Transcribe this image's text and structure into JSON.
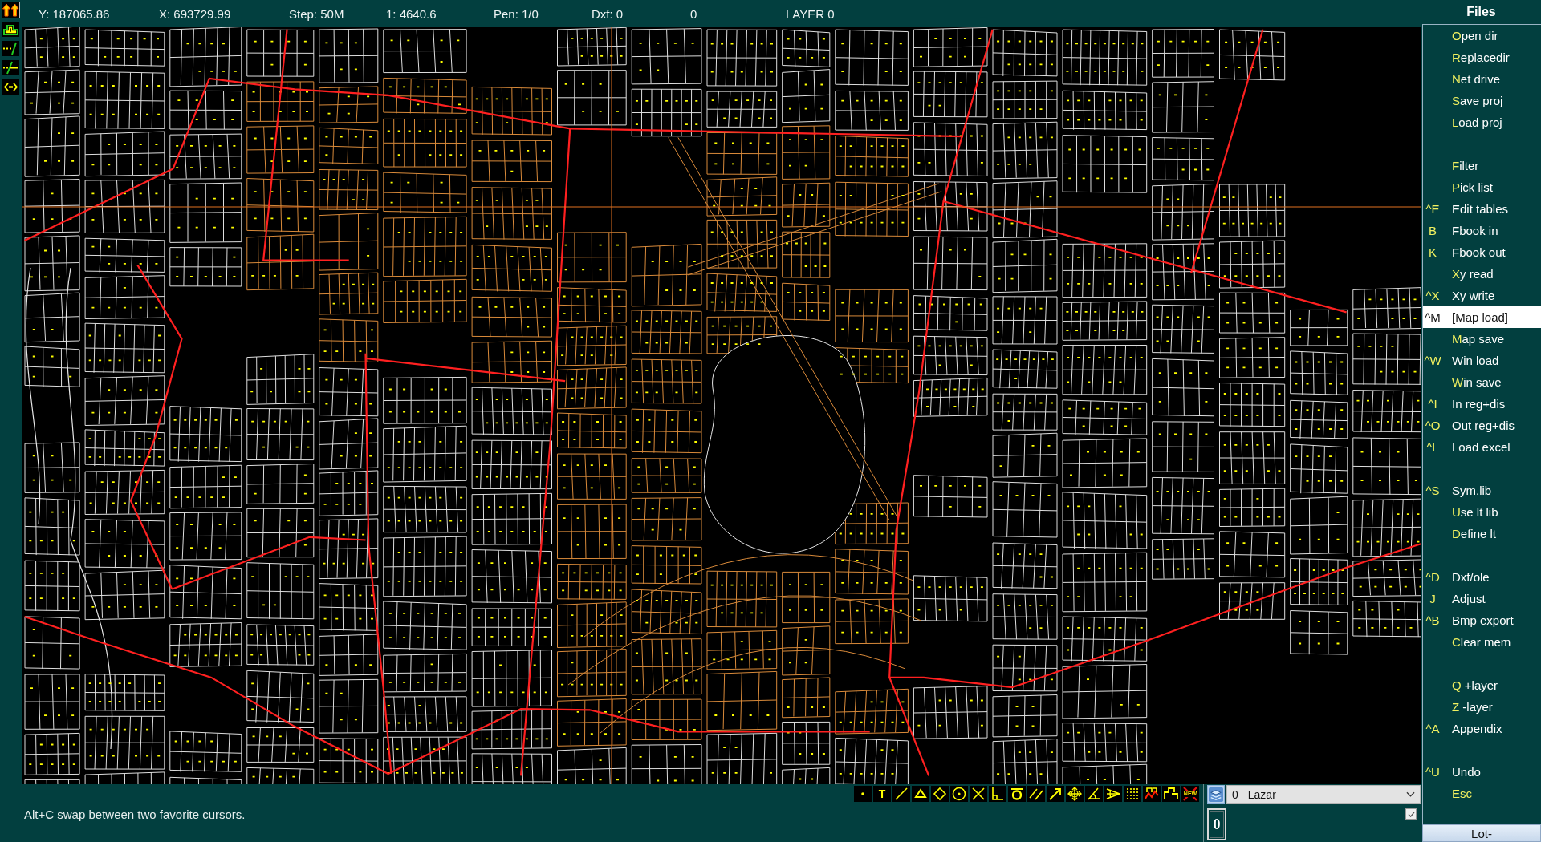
{
  "status_bar": {
    "fields": [
      "Y: 187065.86",
      "X: 693729.99",
      "Step: 50M",
      "1: 4640.6",
      "Pen: 1/0",
      "Dxf: 0",
      "0",
      "LAYER 0"
    ]
  },
  "left_toolbar": [
    {
      "kind": "arrows",
      "selected": true
    },
    {
      "kind": "outline",
      "selected": false
    },
    {
      "kind": "extend",
      "selected": false
    },
    {
      "kind": "trim",
      "selected": false
    },
    {
      "kind": "swap",
      "selected": false
    }
  ],
  "command_bar": {
    "hint": "Alt+C swap between two favorite cursors.",
    "tools": [
      {
        "kind": "point"
      },
      {
        "kind": "text",
        "label": "T"
      },
      {
        "kind": "line"
      },
      {
        "kind": "triangle"
      },
      {
        "kind": "diamond"
      },
      {
        "kind": "circle"
      },
      {
        "kind": "cross"
      },
      {
        "kind": "corner"
      },
      {
        "kind": "ring"
      },
      {
        "kind": "parallel"
      },
      {
        "kind": "arrow"
      },
      {
        "kind": "move"
      },
      {
        "kind": "angle"
      },
      {
        "kind": "fan"
      },
      {
        "kind": "grid"
      },
      {
        "kind": "zigzag"
      },
      {
        "kind": "bracket"
      },
      {
        "kind": "new",
        "label": "NEW"
      }
    ],
    "layer_select": {
      "number": "0",
      "name": "Lazar"
    },
    "checkbox": {
      "checked": true
    },
    "counter": "0"
  },
  "menu": {
    "title": "Files",
    "groups": [
      [
        {
          "kind": "item",
          "label": "Open dir",
          "hotkey": true,
          "selected": false
        },
        {
          "kind": "item",
          "label": "Replacedir",
          "hotkey": true,
          "selected": false
        },
        {
          "kind": "item",
          "label": "Net drive",
          "hotkey": true,
          "selected": false
        },
        {
          "kind": "item",
          "label": "Save proj",
          "hotkey": true,
          "selected": false
        },
        {
          "kind": "item",
          "label": "Load proj",
          "hotkey": true,
          "selected": false
        }
      ],
      [
        {
          "kind": "item",
          "label": "Filter",
          "hotkey": true,
          "selected": false
        },
        {
          "kind": "item",
          "label": "Pick list",
          "hotkey": true,
          "selected": false
        },
        {
          "kind": "item",
          "shortcut": "^E",
          "label": "Edit tables",
          "hotkey": false,
          "selected": false
        },
        {
          "kind": "item",
          "shortcut": "B",
          "label": "Fbook in",
          "hotkey": false,
          "selected": false
        },
        {
          "kind": "item",
          "shortcut": "K",
          "label": "Fbook out",
          "hotkey": false,
          "selected": false
        },
        {
          "kind": "item",
          "label": "Xy read",
          "hotkey": true,
          "selected": false
        },
        {
          "kind": "item",
          "shortcut": "^X",
          "label": "Xy write",
          "hotkey": false,
          "selected": false
        },
        {
          "kind": "item",
          "shortcut": "^M",
          "label": "[Map load]",
          "hotkey": false,
          "selected": true
        },
        {
          "kind": "item",
          "label": "Map save",
          "hotkey": true,
          "selected": false
        },
        {
          "kind": "item",
          "shortcut": "^W",
          "label": "Win load",
          "hotkey": false,
          "selected": false
        },
        {
          "kind": "item",
          "label": "Win save",
          "hotkey": true,
          "selected": false
        },
        {
          "kind": "item",
          "shortcut": "^I",
          "label": "In reg+dis",
          "hotkey": false,
          "selected": false
        },
        {
          "kind": "item",
          "shortcut": "^O",
          "label": "Out reg+dis",
          "hotkey": false,
          "selected": false
        },
        {
          "kind": "item",
          "shortcut": "^L",
          "label": "Load excel",
          "hotkey": false,
          "selected": false
        }
      ],
      [
        {
          "kind": "item",
          "shortcut": "^S",
          "label": "Sym.lib",
          "hotkey": false,
          "selected": false
        },
        {
          "kind": "item",
          "label": "Use lt lib",
          "hotkey": true,
          "selected": false
        },
        {
          "kind": "item",
          "label": "Define lt",
          "hotkey": true,
          "selected": false
        }
      ],
      [
        {
          "kind": "item",
          "shortcut": "^D",
          "label": "Dxf/ole",
          "hotkey": false,
          "selected": false
        },
        {
          "kind": "item",
          "shortcut": "J",
          "label": "Adjust",
          "hotkey": false,
          "selected": false
        },
        {
          "kind": "item",
          "shortcut": "^B",
          "label": "Bmp export",
          "hotkey": false,
          "selected": false
        },
        {
          "kind": "item",
          "label": "Clear mem",
          "hotkey": true,
          "selected": false
        }
      ],
      [
        {
          "kind": "item",
          "label": "Q +layer",
          "hotkey": true,
          "selected": false
        },
        {
          "kind": "item",
          "label": "Z -layer",
          "hotkey": true,
          "selected": false
        },
        {
          "kind": "item",
          "shortcut": "^A",
          "label": "Appendix",
          "hotkey": false,
          "selected": false
        }
      ],
      [
        {
          "kind": "item",
          "shortcut": "^U",
          "label": "Undo",
          "hotkey": false,
          "selected": false
        },
        {
          "kind": "link",
          "label": "Esc",
          "selected": false
        }
      ]
    ],
    "footer_button": "Lot-"
  }
}
